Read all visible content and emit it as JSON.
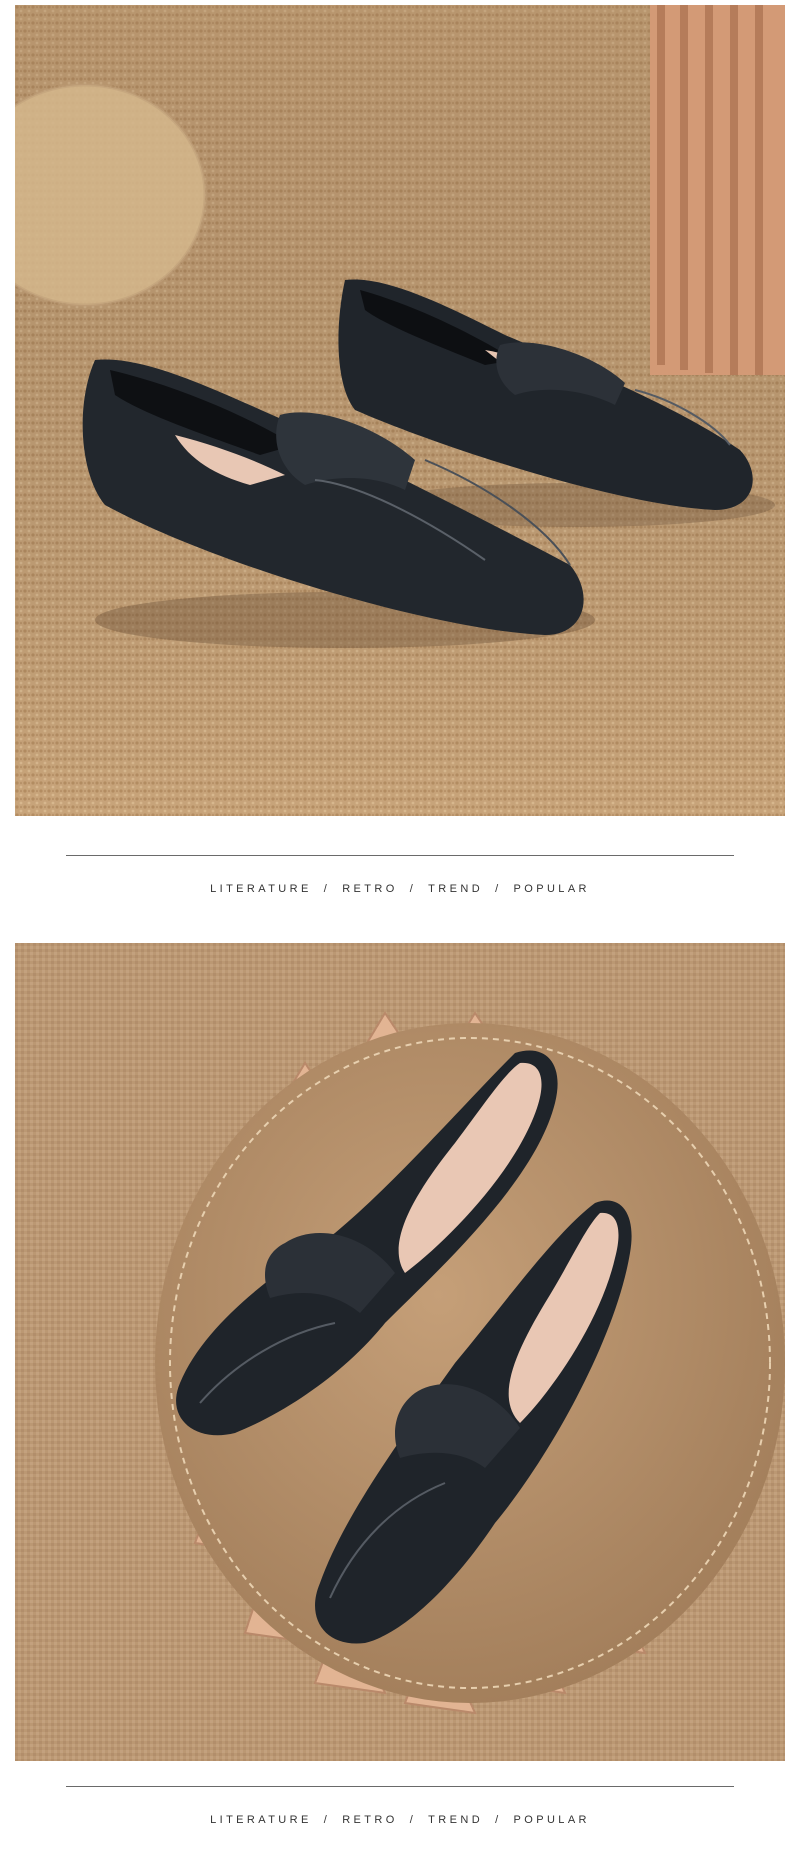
{
  "sections": [
    {
      "image": "black-loafers-on-sisal-rug",
      "tags": [
        "LITERATURE",
        "RETRO",
        "TREND",
        "POPULAR"
      ]
    },
    {
      "image": "black-loafers-on-round-stool",
      "tags": [
        "LITERATURE",
        "RETRO",
        "TREND",
        "POPULAR"
      ]
    }
  ],
  "separator": "/",
  "colors": {
    "background": "#ffffff",
    "rug": "#c9a67c",
    "leather": "#1e2228",
    "lining": "#e9c9b6",
    "rule": "#6a6a6a"
  }
}
